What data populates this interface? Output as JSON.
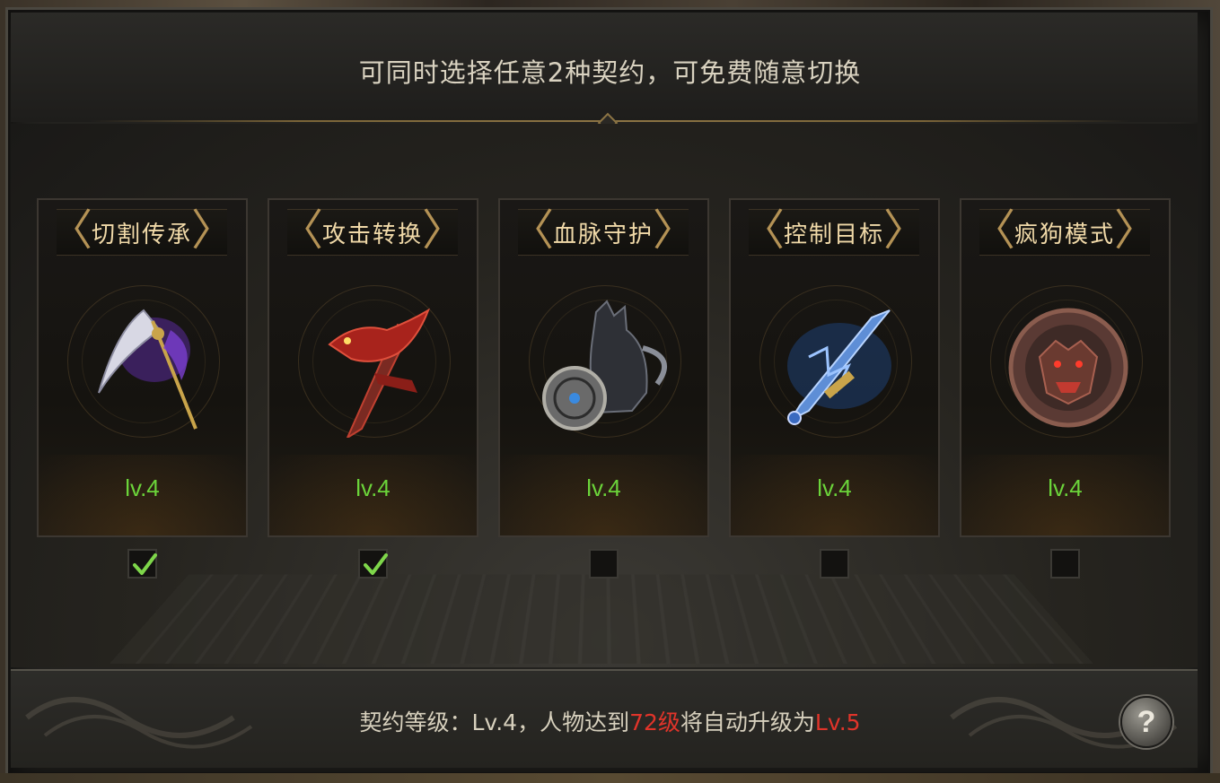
{
  "header": {
    "title": "可同时选择任意2种契约，可免费随意切换"
  },
  "contracts": [
    {
      "name": "切割传承",
      "level": "lv.4",
      "selected": true,
      "icon": "purple-scythe-icon"
    },
    {
      "name": "攻击转换",
      "level": "lv.4",
      "selected": true,
      "icon": "red-dragon-sword-icon"
    },
    {
      "name": "血脉守护",
      "level": "lv.4",
      "selected": false,
      "icon": "wolf-shield-icon"
    },
    {
      "name": "控制目标",
      "level": "lv.4",
      "selected": false,
      "icon": "blue-lightning-sword-icon"
    },
    {
      "name": "疯狗模式",
      "level": "lv.4",
      "selected": false,
      "icon": "red-beast-head-icon"
    }
  ],
  "footer": {
    "prefix": "契约等级：Lv.4，人物达到",
    "target_level": "72级",
    "middle": "将自动升级为",
    "next_level": "Lv.5"
  },
  "help": {
    "label": "?"
  },
  "colors": {
    "level_green": "#6bd43a",
    "title_gold": "#f0d9a8",
    "highlight_red": "#e0342a",
    "bracket_gold": "#b49255"
  }
}
